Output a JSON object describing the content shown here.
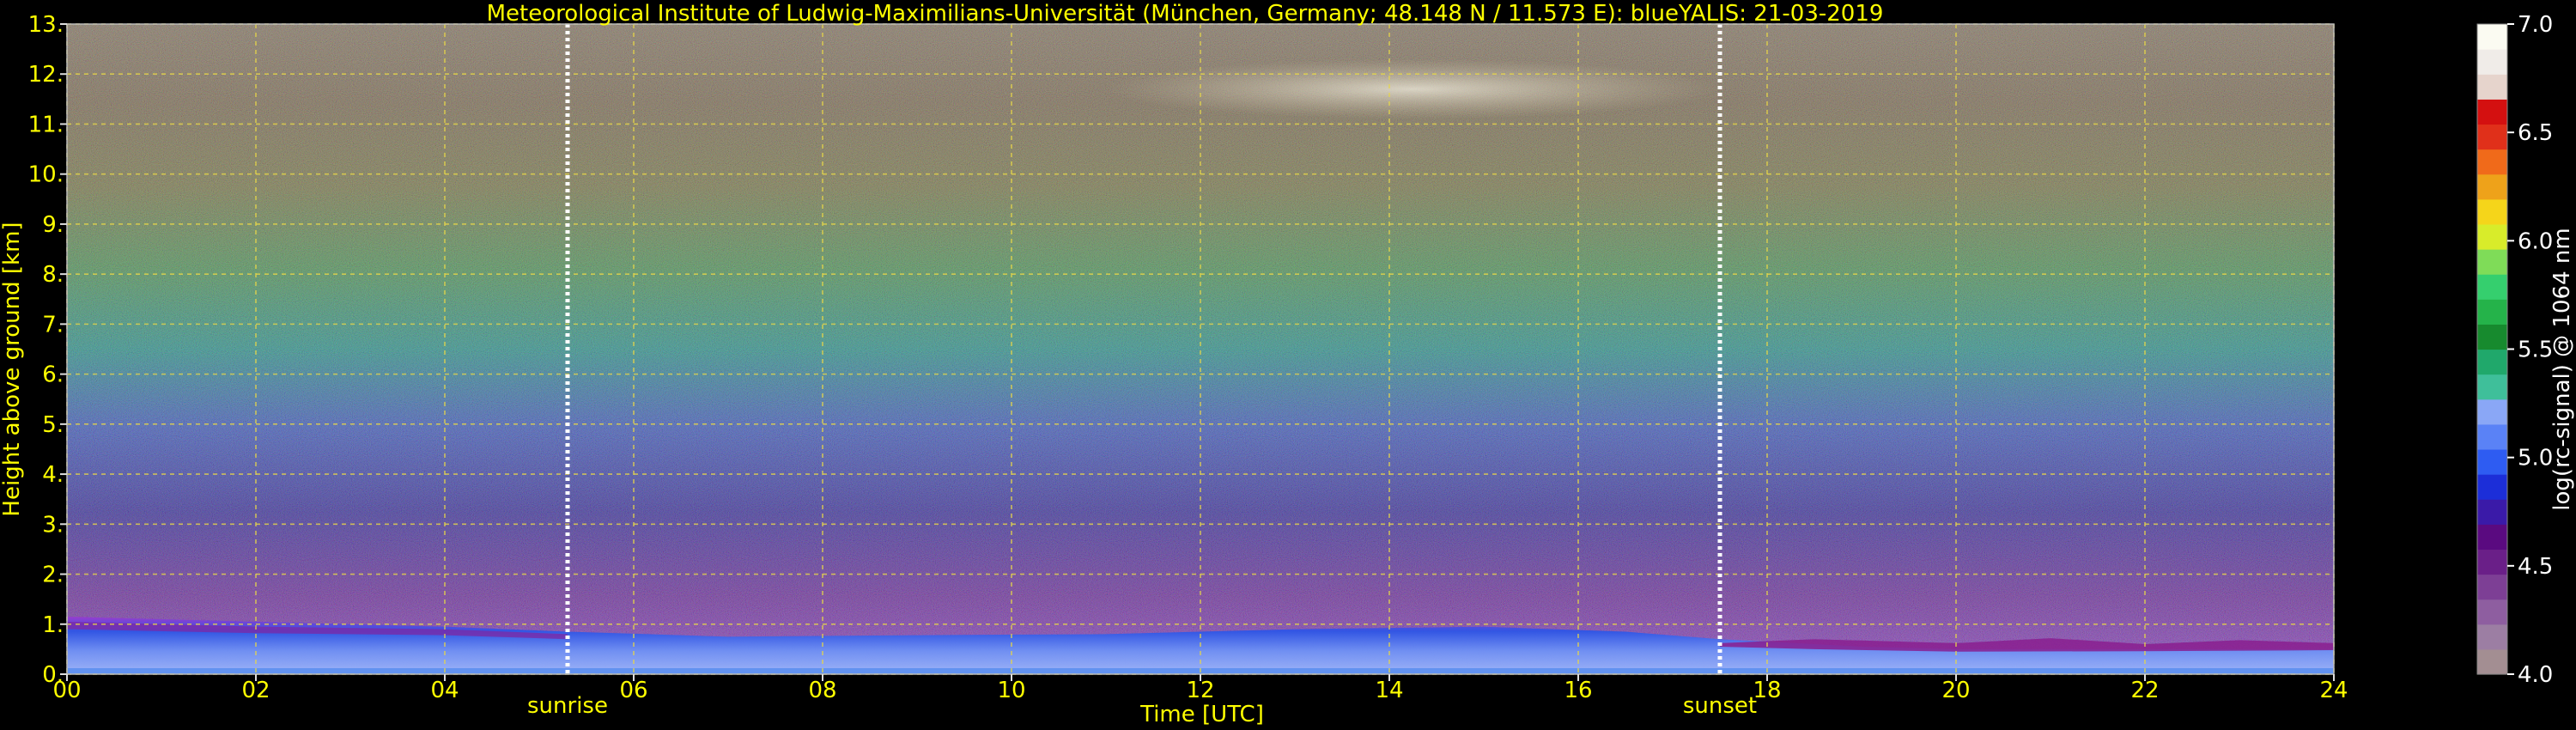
{
  "chart_data": {
    "type": "heatmap",
    "title": "Meteorological Institute of Ludwig-Maximilians-Universität (München, Germany; 48.148 N / 11.573 E):    blueYALIS: 21-03-2019",
    "xlabel": "Time [UTC]",
    "ylabel": "Height above ground [km]",
    "xlim": [
      0,
      24
    ],
    "ylim": [
      0,
      13
    ],
    "x_ticks": [
      "00",
      "02",
      "04",
      "06",
      "08",
      "10",
      "12",
      "14",
      "16",
      "18",
      "20",
      "22",
      "24"
    ],
    "y_ticks": [
      "0.",
      "1.",
      "2.",
      "3.",
      "4.",
      "5.",
      "6.",
      "7.",
      "8.",
      "9.",
      "10.",
      "11.",
      "12.",
      "13."
    ],
    "grid": true,
    "markers": [
      {
        "label": "sunrise",
        "x": 5.3
      },
      {
        "label": "sunset",
        "x": 17.5
      }
    ],
    "colorbar": {
      "label": "log(rc-signal) @ 1064 nm",
      "range": [
        4.0,
        7.0
      ],
      "ticks": [
        "4.0",
        "4.5",
        "5.0",
        "5.5",
        "6.0",
        "6.5",
        "7.0"
      ],
      "colors": [
        "#a38e92",
        "#9c7ea3",
        "#8e5ea0",
        "#7d3f95",
        "#6a1f88",
        "#5a0a80",
        "#3a1aa8",
        "#1c2ed8",
        "#2e5cf2",
        "#5a82f6",
        "#8aa7f6",
        "#3fbf9a",
        "#20a86b",
        "#178a2e",
        "#25b34a",
        "#35cf6e",
        "#7fdc58",
        "#d8ec2a",
        "#f5d51a",
        "#eea21a",
        "#f06a1a",
        "#e0301a",
        "#d41010",
        "#e6d4cc",
        "#f0ece8",
        "#fbfbf2"
      ]
    },
    "boundary_layer_top_km": [
      {
        "t": 0,
        "h": 1.15
      },
      {
        "t": 2,
        "h": 1.05
      },
      {
        "t": 4,
        "h": 0.95
      },
      {
        "t": 5.3,
        "h": 0.85
      },
      {
        "t": 7,
        "h": 0.75
      },
      {
        "t": 9,
        "h": 0.78
      },
      {
        "t": 11,
        "h": 0.8
      },
      {
        "t": 13,
        "h": 0.9
      },
      {
        "t": 15,
        "h": 0.95
      },
      {
        "t": 16.5,
        "h": 0.85
      },
      {
        "t": 17.5,
        "h": 0.7
      },
      {
        "t": 19,
        "h": 0.55
      },
      {
        "t": 20,
        "h": 0.5
      },
      {
        "t": 22,
        "h": 0.5
      },
      {
        "t": 24,
        "h": 0.5
      }
    ],
    "cirrus_layer": {
      "t_start": 11,
      "t_end": 17.5,
      "h_min_km": 11.1,
      "h_max_km": 12.3
    }
  },
  "colors": {
    "text": "#ffff00",
    "grid": "#e6d64a",
    "marker_line": "#ffffff",
    "colorbar_text": "#ffffff"
  }
}
